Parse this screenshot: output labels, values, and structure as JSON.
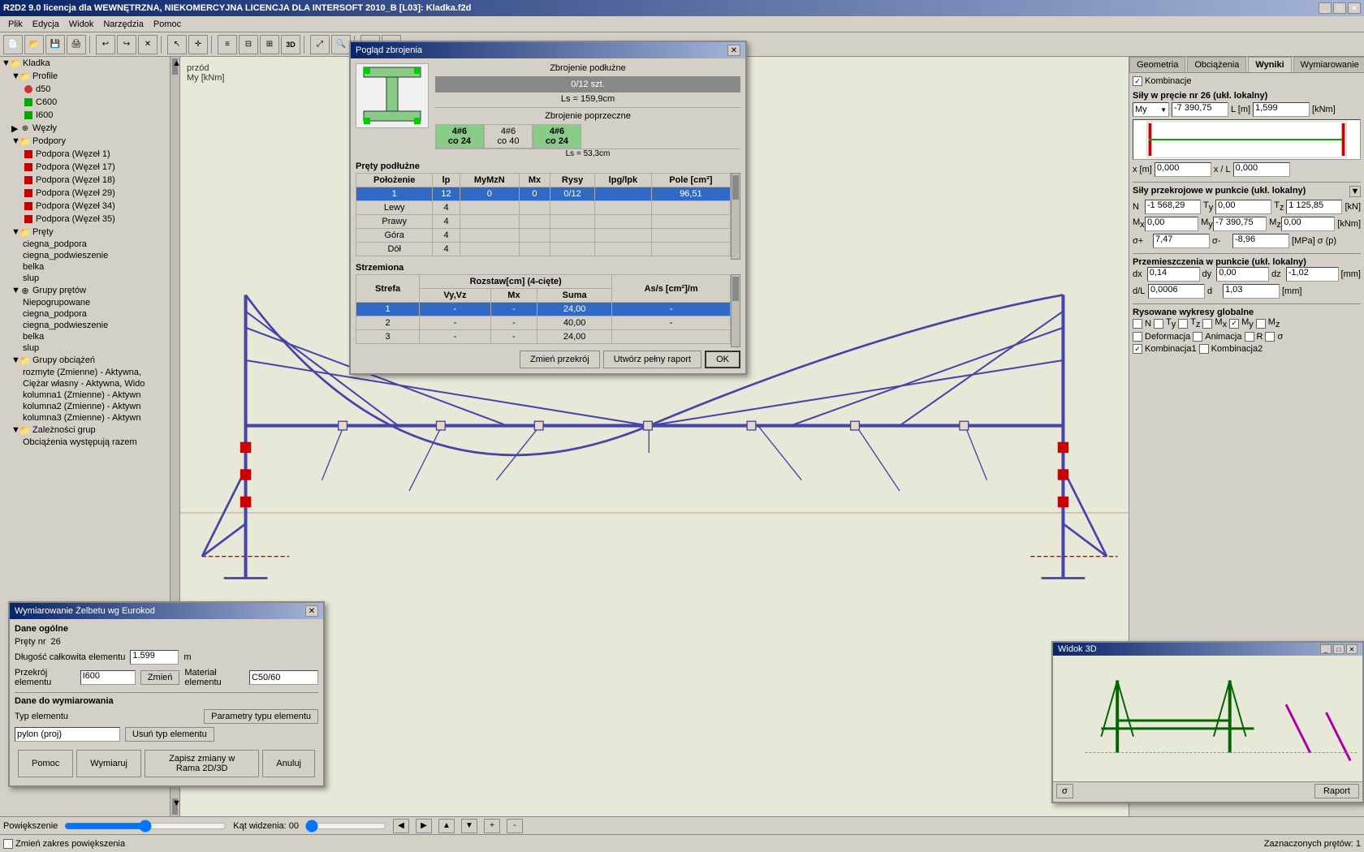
{
  "app": {
    "title": "R2D2 9.0 licencja dla WEWNĘTRZNA, NIEKOMERCYJNA LICENCJA DLA INTERSOFT 2010_B [L03]: Kladka.f2d"
  },
  "menu": {
    "items": [
      "Plik",
      "Edycja",
      "Widok",
      "Narzędzia",
      "Pomoc"
    ]
  },
  "sidebar": {
    "tree": [
      {
        "label": "Kladka",
        "level": 0,
        "type": "folder",
        "expand": true
      },
      {
        "label": "Profile",
        "level": 1,
        "type": "folder",
        "expand": true
      },
      {
        "label": "d50",
        "level": 2,
        "type": "red-circle"
      },
      {
        "label": "C600",
        "level": 2,
        "type": "green-sq"
      },
      {
        "label": "I600",
        "level": 2,
        "type": "green-sq"
      },
      {
        "label": "Węzły",
        "level": 1,
        "type": "nodes",
        "expand": false
      },
      {
        "label": "Podpory",
        "level": 1,
        "type": "folder",
        "expand": true
      },
      {
        "label": "Podpora (Węzeł 1)",
        "level": 2,
        "type": "red-sq"
      },
      {
        "label": "Podpora (Węzeł 17)",
        "level": 2,
        "type": "red-sq"
      },
      {
        "label": "Podpora (Węzeł 18)",
        "level": 2,
        "type": "red-sq"
      },
      {
        "label": "Podpora (Węzeł 29)",
        "level": 2,
        "type": "red-sq"
      },
      {
        "label": "Podpora (Węzeł 34)",
        "level": 2,
        "type": "red-sq"
      },
      {
        "label": "Podpora (Węzeł 35)",
        "level": 2,
        "type": "red-sq"
      },
      {
        "label": "Pręty",
        "level": 1,
        "type": "folder",
        "expand": true
      },
      {
        "label": "ciegna_podpora",
        "level": 2,
        "type": "plain"
      },
      {
        "label": "ciegna_podwieszenie",
        "level": 2,
        "type": "plain"
      },
      {
        "label": "belka",
        "level": 2,
        "type": "plain"
      },
      {
        "label": "slup",
        "level": 2,
        "type": "plain"
      },
      {
        "label": "Grupy prętów",
        "level": 1,
        "type": "folder",
        "expand": true
      },
      {
        "label": "Niepogrupowane",
        "level": 2,
        "type": "plain"
      },
      {
        "label": "ciegna_podpora",
        "level": 2,
        "type": "plain"
      },
      {
        "label": "ciegna_podwieszenie",
        "level": 2,
        "type": "plain"
      },
      {
        "label": "belka",
        "level": 2,
        "type": "plain"
      },
      {
        "label": "slup",
        "level": 2,
        "type": "plain"
      },
      {
        "label": "Grupy obciążeń",
        "level": 1,
        "type": "folder",
        "expand": true
      },
      {
        "label": "rozmyte (Zmienne) - Aktywna,",
        "level": 2,
        "type": "plain"
      },
      {
        "label": "Ciężar własny - Aktywna, Wido",
        "level": 2,
        "type": "plain"
      },
      {
        "label": "kolumna1 (Zmienne) - Aktywn",
        "level": 2,
        "type": "plain"
      },
      {
        "label": "kolumna2 (Zmienne) - Aktywn",
        "level": 2,
        "type": "plain"
      },
      {
        "label": "kolumna3 (Zmienne) - Aktywn",
        "level": 2,
        "type": "plain"
      },
      {
        "label": "Zależności grup",
        "level": 1,
        "type": "folder",
        "expand": true
      },
      {
        "label": "Obciążenia występują razem",
        "level": 2,
        "type": "plain"
      }
    ]
  },
  "canvas": {
    "label_poczatek": "przód",
    "label_jednostka": "My [kNm]"
  },
  "right_panel": {
    "tabs": [
      "Geometria",
      "Obciążenia",
      "Wyniki",
      "Wymiarowanie"
    ],
    "active_tab": "Wyniki",
    "kombinacje_checked": true,
    "sily_w_precie_nr": "26",
    "sily_uklad": "ukł. lokalny",
    "My_value": "-7 390,75",
    "L_label": "L [m]",
    "L_value": "1,599",
    "kNm_label": "[kNm]",
    "x_label": "x [m]",
    "x_value": "0,000",
    "xL_label": "x / L",
    "xL_value": "0,000",
    "przekrojowe_title": "Siły przekrojowe w punkcie (ukł. lokalny)",
    "N_value": "-1 568,29",
    "Ty_value": "0,00",
    "Tz_value": "1 125,85",
    "kN_label": "[kN]",
    "Mx_value": "0,00",
    "My_przekr": "-7 390,75",
    "Mz_value": "0,00",
    "kNm2_label": "[kNm]",
    "sigma_plus": "7,47",
    "sigma_minus": "-8,96",
    "MPa_label": "[MPa]",
    "przemieszczenia_title": "Przemieszczenia w punkcie (ukł. lokalny)",
    "dx_value": "0,14",
    "dy_value": "0,00",
    "dz_value": "-1,02",
    "mm_label": "[mm]",
    "dL_value": "0,0006",
    "d_value": "1,03",
    "mm2_label": "[mm]",
    "wykresy_title": "Rysowane wykresy globalne",
    "chk_N": false,
    "chk_Ty": false,
    "chk_Tz": false,
    "chk_Mx": false,
    "chk_My": true,
    "chk_Mz": false,
    "chk_Deformacja": false,
    "chk_Animacja": false,
    "chk_R": false,
    "chk_sigma": false,
    "chk_Kombinacja1": true,
    "chk_Kombinacja2": false
  },
  "modal_zbrojenie": {
    "title": "Pogląd zbrojenia",
    "zbrojenie_podluzne_title": "Zbrojenie podłużne",
    "bar_label": "0/12 szt.",
    "ls_label": "Ls = 159,9cm",
    "zbrojenie_poprzeczne_title": "Zbrojenie poprzeczne",
    "poprz_cells": [
      {
        "label": "4#6",
        "sublabel": "co 24"
      },
      {
        "label": "4#6",
        "sublabel": "co 40"
      },
      {
        "label": "4#6",
        "sublabel": "co 24"
      }
    ],
    "ls2_label": "Ls = 53,3cm",
    "prety_podluzne_title": "Pręty podłużne",
    "col_polozenie": "Położenie",
    "col_lp": "lp",
    "col_MyMzN": "MyMzN",
    "col_Mx": "Mx",
    "col_Rysy": "Rysy",
    "col_lpglpk": "lpg/lpk",
    "col_pole": "Pole [cm²]",
    "rows_podluzne": [
      {
        "polozenie": "Lewy",
        "lp": "4",
        "MyMzN": "",
        "Mx": "",
        "Rysy": "",
        "lpglpk": "",
        "pole": ""
      },
      {
        "polozenie": "Prawy",
        "lp": "4",
        "MyMzN": "",
        "Mx": "",
        "Rysy": "",
        "lpglpk": "",
        "pole": ""
      },
      {
        "polozenie": "Góra",
        "lp": "4",
        "MyMzN": "",
        "Mx": "",
        "Rysy": "",
        "lpglpk": "",
        "pole": ""
      },
      {
        "polozenie": "Dół",
        "lp": "4",
        "MyMzN": "",
        "Mx": "",
        "Rysy": "",
        "lpglpk": "",
        "pole": ""
      }
    ],
    "selected_row": {
      "polozenie": "1",
      "lp": "12",
      "MyMzN": "0",
      "Mx": "0",
      "Rysy": "0/12",
      "lpglpk": "",
      "pole": "96,51"
    },
    "strzemiona_title": "Strzemiona",
    "col_strefa": "Strefa",
    "col_rozstaw": "Rozstaw[cm] (4-cięte)",
    "col_VyVz": "Vy,Vz",
    "col_Mx2": "Mx",
    "col_Suma": "Suma",
    "col_Asis": "As/s [cm²]/m",
    "rows_strzemiona": [
      {
        "strefa": "1",
        "VyVz": "-",
        "Mx": "-",
        "Suma": "24,00",
        "Asis": "-",
        "selected": true
      },
      {
        "strefa": "2",
        "VyVz": "-",
        "Mx": "-",
        "Suma": "40,00",
        "Asis": "-"
      },
      {
        "strefa": "3",
        "VyVz": "-",
        "Mx": "-",
        "Suma": "24,00",
        "Asis": ""
      }
    ],
    "btn_zmien": "Zmień przekrój",
    "btn_pelny": "Utwórz pełny raport",
    "btn_ok": "OK"
  },
  "modal_wymiarowanie": {
    "title": "Wymiarowanie Żelbetu wg Eurokod",
    "dane_ogolne_title": "Dane ogólne",
    "prety_nr_label": "Pręty nr",
    "prety_nr_value": "26",
    "dlugosc_label": "Długość całkowita elementu",
    "dlugosc_value": "1.599",
    "dlugosc_unit": "m",
    "przekroj_label": "Przekrój elementu",
    "przekroj_value": "I600",
    "btn_zmien": "Zmień",
    "material_label": "Materiał elementu",
    "material_value": "C50/60",
    "dane_wym_title": "Dane do wymiarowania",
    "typ_elementu_label": "Typ elementu",
    "btn_parametry": "Parametry typu elementu",
    "typ_value": "pylon (proj)",
    "btn_usun": "Usuń typ elementu",
    "btn_pomoc": "Pomoc",
    "btn_wymiaruj": "Wymiaruj",
    "btn_zapisz": "Zapisz zmiany w Rama 2D/3D",
    "btn_anuluj": "Anuluj"
  },
  "widok3d": {
    "title": "Widok 3D",
    "btn_raport": "Raport",
    "btn_sigma": "σ"
  },
  "status_bar": {
    "zoom_label": "Powiększenie",
    "angle_label": "Kąt widzenia: 00",
    "change_zoom_label": "Zmień zakres powiększenia",
    "zaznaczonych_label": "Zaznaczonych prętów: 1"
  }
}
